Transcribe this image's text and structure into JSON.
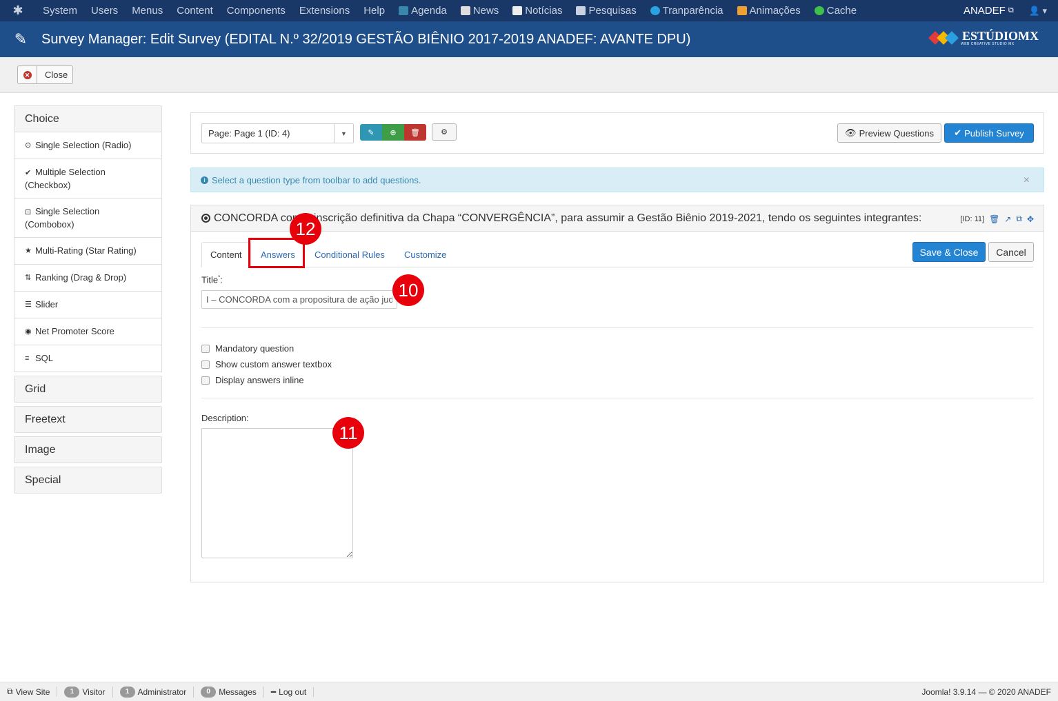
{
  "topbar": {
    "menu": [
      "System",
      "Users",
      "Menus",
      "Content",
      "Components",
      "Extensions",
      "Help"
    ],
    "shortcuts": [
      {
        "label": "Agenda",
        "icon": "calendar-icon",
        "color": "#3a87ad"
      },
      {
        "label": "News",
        "icon": "newspaper-icon",
        "color": "#dddddd"
      },
      {
        "label": "Notícias",
        "icon": "document-icon",
        "color": "#eeeeee"
      },
      {
        "label": "Pesquisas",
        "icon": "list-icon",
        "color": "#c8d2e0"
      },
      {
        "label": "Tranparência",
        "icon": "download-icon",
        "color": "#2aa1e0"
      },
      {
        "label": "Animações",
        "icon": "layers-icon",
        "color": "#f0a030"
      },
      {
        "label": "Cache",
        "icon": "refresh-icon",
        "color": "#3ec04a"
      }
    ],
    "site_name": "ANADEF"
  },
  "header": {
    "title": "Survey Manager: Edit Survey (EDITAL N.º 32/2019 GESTÃO BIÊNIO 2017-2019 ANADEF: AVANTE DPU)",
    "brand": "ESTÚDIOMX",
    "brand_sub": "WEB CREATIVE STUDIO MX"
  },
  "toolbar": {
    "close_label": "Close"
  },
  "sidebar": {
    "choice_label": "Choice",
    "choice_items": [
      {
        "label": "Single Selection (Radio)",
        "icon": "radio-icon",
        "glyph": "⊙"
      },
      {
        "label": "Multiple Selection (Checkbox)",
        "icon": "check-circle-icon",
        "glyph": "✔"
      },
      {
        "label": "Single Selection (Combobox)",
        "icon": "combobox-icon",
        "glyph": "⊡"
      },
      {
        "label": "Multi-Rating (Star Rating)",
        "icon": "star-icon",
        "glyph": "★"
      },
      {
        "label": "Ranking (Drag & Drop)",
        "icon": "sort-icon",
        "glyph": "⇅"
      },
      {
        "label": "Slider",
        "icon": "sliders-icon",
        "glyph": "☰"
      },
      {
        "label": "Net Promoter Score",
        "icon": "gauge-icon",
        "glyph": "◉"
      },
      {
        "label": "SQL",
        "icon": "database-icon",
        "glyph": "≡"
      }
    ],
    "groups": [
      "Grid",
      "Freetext",
      "Image",
      "Special"
    ]
  },
  "pagebar": {
    "page_select": "Page: Page 1 (ID: 4)",
    "preview_label": "Preview Questions",
    "publish_label": "Publish Survey"
  },
  "alert": {
    "text": "Select a question type from toolbar to add questions."
  },
  "question": {
    "title": "CONCORDA com a inscrição definitiva da Chapa “CONVERGÊNCIA”, para assumir a Gestão Biênio 2019-2021, tendo os seguintes integrantes:",
    "id_label": "[ID: 11]",
    "tabs": [
      "Content",
      "Answers",
      "Conditional Rules",
      "Customize"
    ],
    "save_label": "Save & Close",
    "cancel_label": "Cancel",
    "title_label": "Title",
    "title_value": "I – CONCORDA com a propositura de ação judicial",
    "checkboxes": [
      "Mandatory question",
      "Show custom answer textbox",
      "Display answers inline"
    ],
    "description_label": "Description:"
  },
  "annotations": {
    "badge_10": "10",
    "badge_11": "11",
    "badge_12": "12",
    "color": "#e8000b"
  },
  "footer": {
    "view_site": "View Site",
    "visitor_count": "1",
    "visitor_label": "Visitor",
    "admin_count": "1",
    "admin_label": "Administrator",
    "messages_count": "0",
    "messages_label": "Messages",
    "logout": "Log out",
    "version": "Joomla! 3.9.14  —  © 2020 ANADEF"
  }
}
